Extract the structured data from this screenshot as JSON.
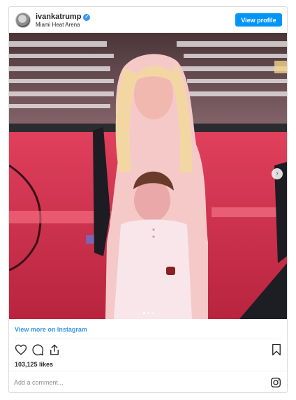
{
  "post": {
    "username": "ivankatrump",
    "verified_badge": "✓",
    "location": "Miami Heat Arena",
    "view_profile_label": "View profile"
  },
  "photo": {
    "carousel_dots": 3,
    "active_dot": 1,
    "next_arrow": "›"
  },
  "footer": {
    "view_more_label": "View more on Instagram",
    "likes_label": "103,125 likes",
    "comment_placeholder": "Add a comment..."
  },
  "icons": [
    "heart-icon",
    "comment-icon",
    "share-icon",
    "bookmark-icon",
    "instagram-icon",
    "next-arrow-icon"
  ],
  "colors": {
    "accent": "#0095f6",
    "link": "#3897f0",
    "text": "#262626",
    "muted": "#8e8e8e",
    "border": "#dbdbdb"
  }
}
